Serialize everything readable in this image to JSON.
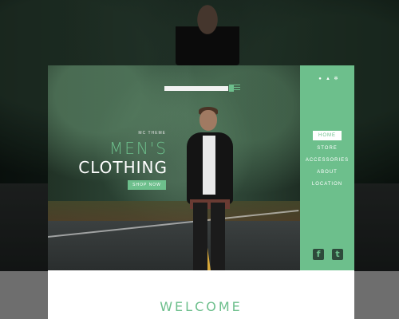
{
  "hero": {
    "theme_label": "MC THEME",
    "title_line1": "MEN'S",
    "title_line2": "CLOTHING",
    "shop_button": "SHOP NOW",
    "search_placeholder": ""
  },
  "sidebar": {
    "icons": [
      "user-icon",
      "cart-icon",
      "settings-icon"
    ],
    "items": [
      {
        "label": "HOME",
        "active": true
      },
      {
        "label": "STORE",
        "active": false
      },
      {
        "label": "ACCESSORIES",
        "active": false
      },
      {
        "label": "ABOUT",
        "active": false
      },
      {
        "label": "LOCATION",
        "active": false
      }
    ],
    "social": [
      {
        "icon": "facebook-icon",
        "glyph": "f"
      },
      {
        "icon": "twitter-icon",
        "glyph": "t"
      }
    ]
  },
  "lower": {
    "welcome": "WELCOME"
  },
  "colors": {
    "accent": "#6dbf8c",
    "white": "#ffffff"
  }
}
